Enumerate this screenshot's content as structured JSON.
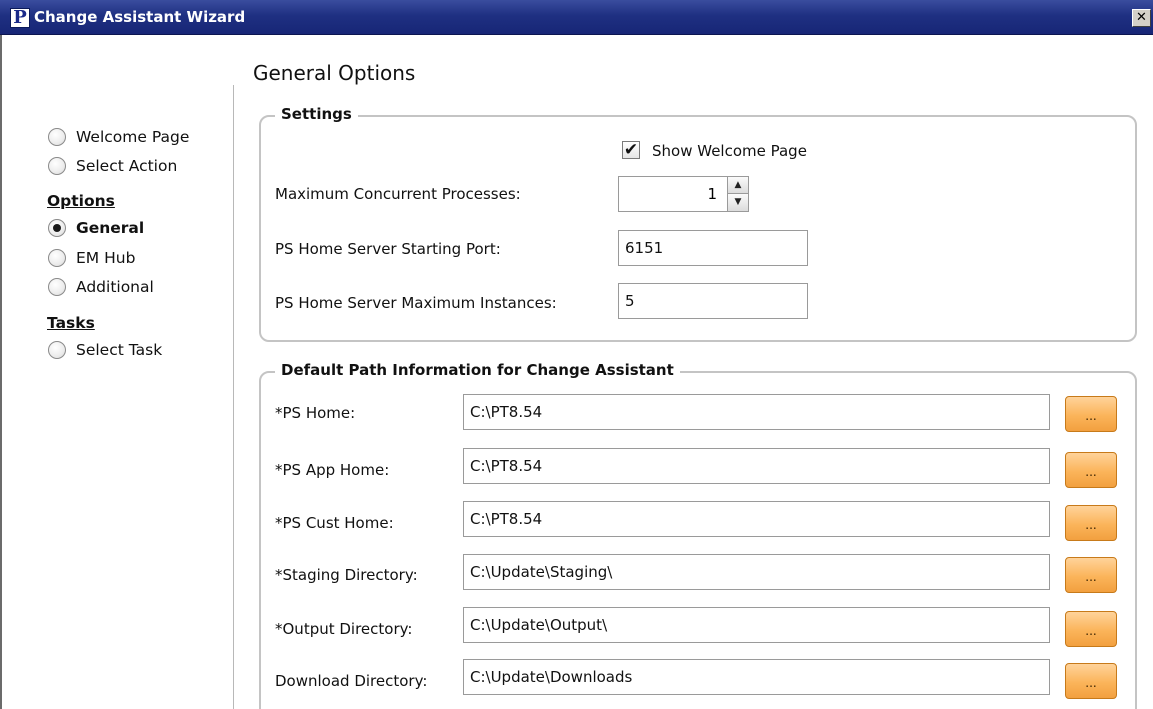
{
  "window": {
    "title": "Change Assistant Wizard",
    "app_icon_letter": "P",
    "close_glyph": "✕"
  },
  "page_title": "General Options",
  "nav": {
    "items_top": [
      {
        "label": "Welcome Page",
        "checked": false
      },
      {
        "label": "Select Action",
        "checked": false
      }
    ],
    "options_heading": "Options",
    "options_items": [
      {
        "label": "General",
        "checked": true
      },
      {
        "label": "EM Hub",
        "checked": false
      },
      {
        "label": "Additional",
        "checked": false
      }
    ],
    "tasks_heading": "Tasks",
    "tasks_items": [
      {
        "label": "Select Task",
        "checked": false
      }
    ]
  },
  "settings": {
    "title": "Settings",
    "show_welcome": {
      "label": "Show Welcome Page",
      "checked": true,
      "mark": "✔"
    },
    "max_concurrent": {
      "label": "Maximum Concurrent Processes:",
      "value": "1",
      "up": "▲",
      "down": "▼"
    },
    "starting_port": {
      "label": "PS Home Server Starting Port:",
      "value": "6151"
    },
    "max_instances": {
      "label": "PS Home Server Maximum Instances:",
      "value": "5"
    }
  },
  "paths": {
    "title": "Default Path Information for Change Assistant",
    "browse_label": "...",
    "rows": [
      {
        "label": "*PS Home:",
        "value": "C:\\PT8.54"
      },
      {
        "label": "*PS App Home:",
        "value": "C:\\PT8.54"
      },
      {
        "label": "*PS Cust Home:",
        "value": "C:\\PT8.54"
      },
      {
        "label": "*Staging Directory:",
        "value": "C:\\Update\\Staging\\"
      },
      {
        "label": "*Output Directory:",
        "value": "C:\\Update\\Output\\"
      },
      {
        "label": "Download Directory:",
        "value": "C:\\Update\\Downloads"
      }
    ]
  },
  "colors": {
    "titlebar": "#1f3082",
    "browse_button": "#fbb45a",
    "group_border": "#c4c4c4"
  }
}
